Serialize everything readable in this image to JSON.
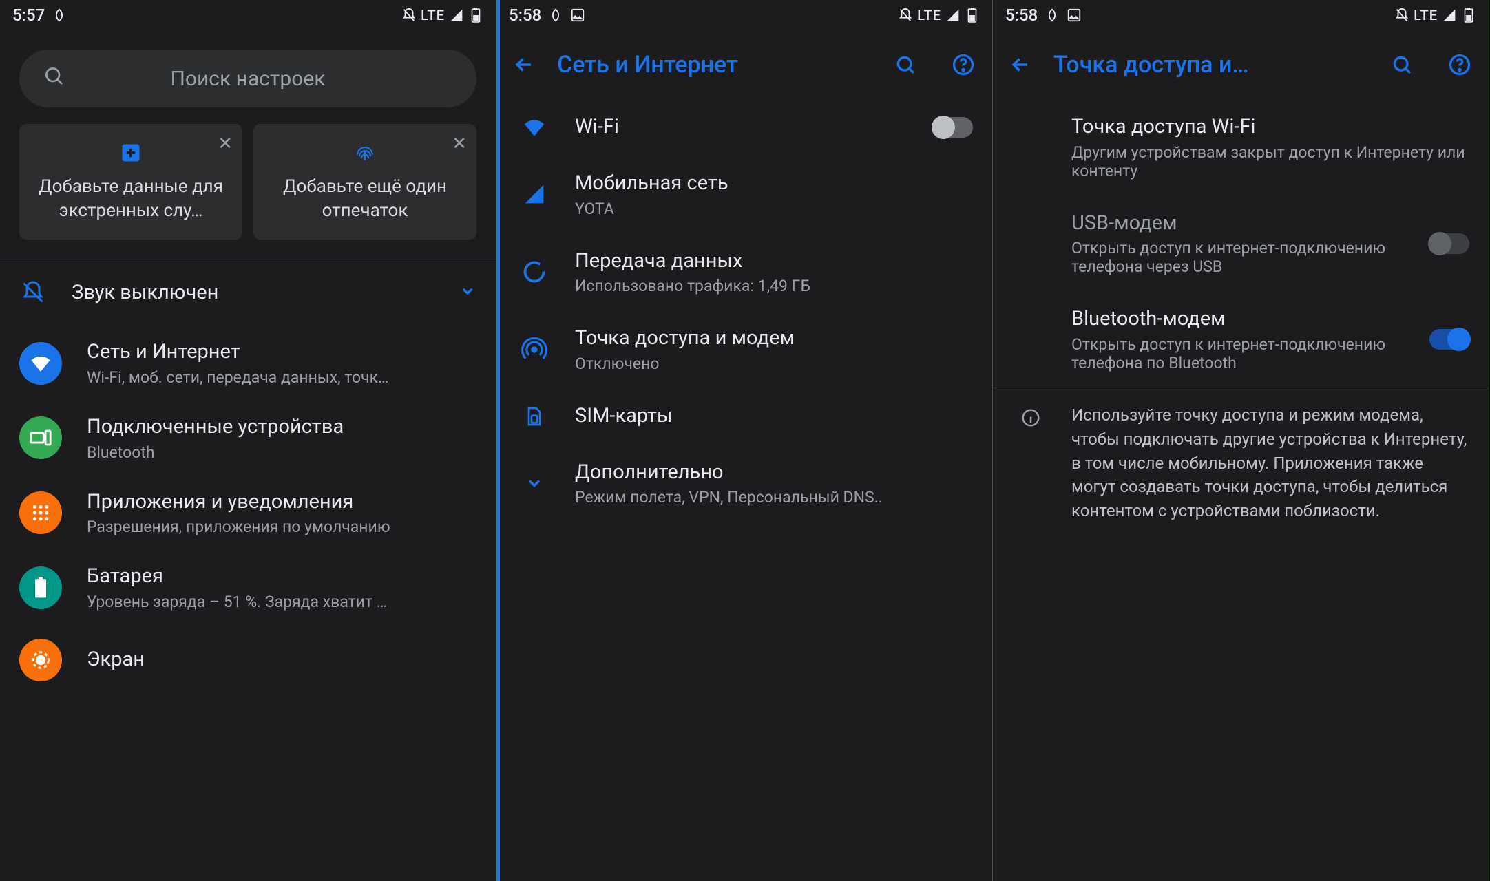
{
  "screen1": {
    "status": {
      "time": "5:57",
      "net": "LTE"
    },
    "search_placeholder": "Поиск настроек",
    "card_emergency": "Добавьте данные для экстренных слу…",
    "card_fingerprint": "Добавьте ещё один отпечаток",
    "sound_off": "Звук выключен",
    "items": {
      "network": {
        "title": "Сеть и Интернет",
        "sub": "Wi-Fi, моб. сети, передача данных, точк…"
      },
      "connected": {
        "title": "Подключенные устройства",
        "sub": "Bluetooth"
      },
      "apps": {
        "title": "Приложения и уведомления",
        "sub": "Разрешения, приложения по умолчанию"
      },
      "battery": {
        "title": "Батарея",
        "sub": "Уровень заряда – 51 %. Заряда хватит …"
      },
      "display": {
        "title": "Экран"
      }
    }
  },
  "screen2": {
    "status": {
      "time": "5:58",
      "net": "LTE"
    },
    "title": "Сеть и Интернет",
    "wifi": "Wi-Fi",
    "mobile": {
      "title": "Мобильная сеть",
      "sub": "YOTA"
    },
    "data": {
      "title": "Передача данных",
      "sub": "Использовано трафика: 1,49 ГБ"
    },
    "hotspot": {
      "title": "Точка доступа и модем",
      "sub": "Отключено"
    },
    "sim": "SIM-карты",
    "advanced": {
      "title": "Дополнительно",
      "sub": "Режим полета, VPN, Персональный DNS.."
    }
  },
  "screen3": {
    "status": {
      "time": "5:58",
      "net": "LTE"
    },
    "title": "Точка доступа и…",
    "wifi_hotspot": {
      "title": "Точка доступа Wi-Fi",
      "sub": "Другим устройствам закрыт доступ к Интернету или контенту"
    },
    "usb": {
      "title": "USB-модем",
      "sub": "Открыть доступ к интернет-подключению телефона через USB"
    },
    "bt": {
      "title": "Bluetooth-модем",
      "sub": "Открыть доступ к интернет-подключению телефона по Bluetooth"
    },
    "info": "Используйте точку доступа и режим модема, чтобы подключать другие устройства к Интернету, в том числе мобильному. Приложения также могут создавать точки доступа, чтобы делиться контентом с устройствами поблизости."
  }
}
